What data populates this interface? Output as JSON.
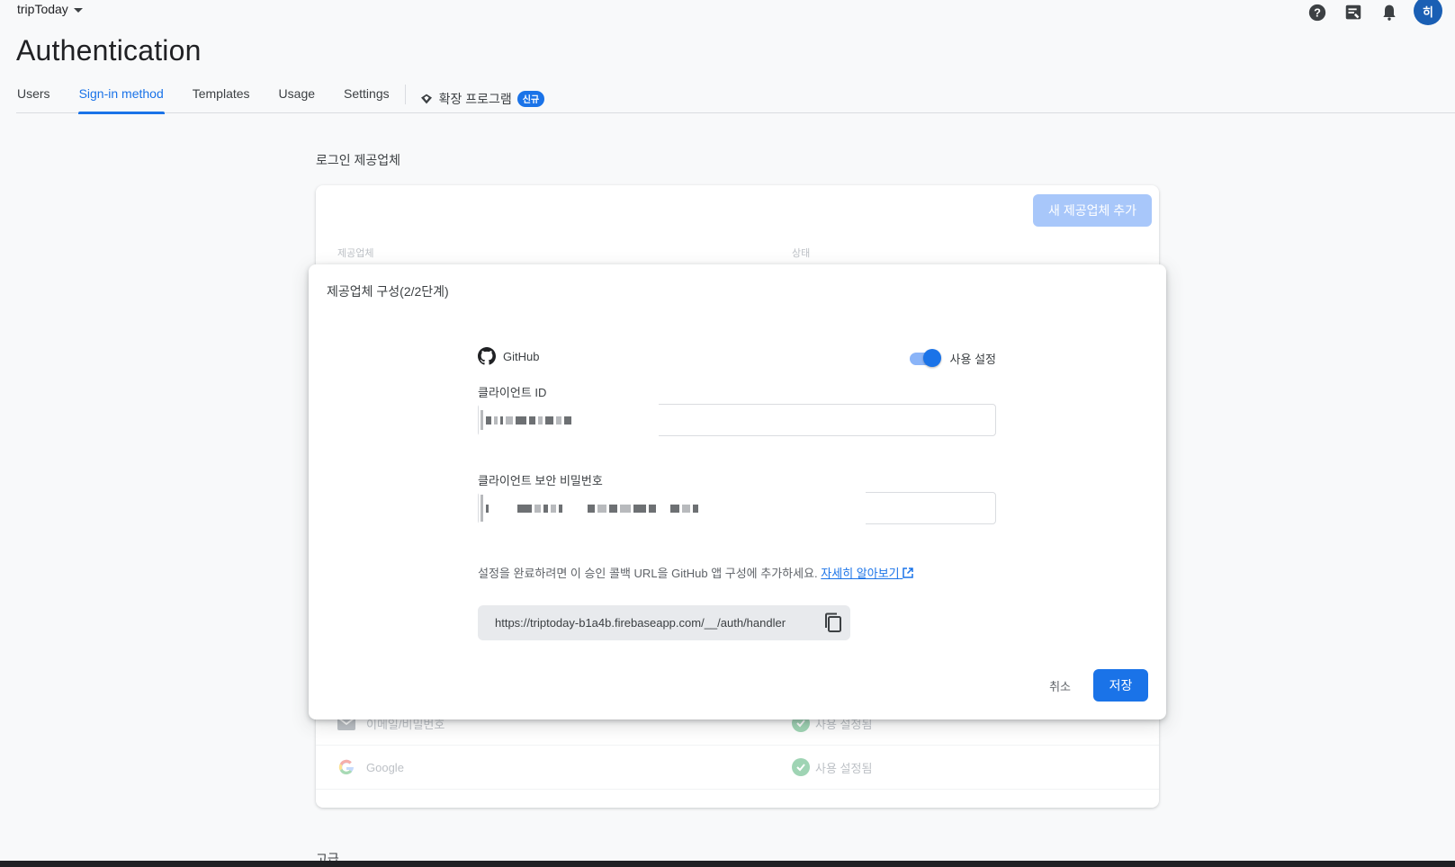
{
  "header": {
    "project_name": "tripToday",
    "page_title": "Authentication",
    "avatar_initial": "히",
    "icons": [
      "help-icon",
      "feedback-icon",
      "notifications-icon"
    ]
  },
  "tabs": [
    {
      "label": "Users"
    },
    {
      "label": "Sign-in method",
      "active": true
    },
    {
      "label": "Templates"
    },
    {
      "label": "Usage"
    },
    {
      "label": "Settings"
    }
  ],
  "extensions_tab": {
    "label": "확장 프로그램",
    "badge": "신규"
  },
  "providers_section": {
    "title": "로그인 제공업체",
    "add_button": "새 제공업체 추가",
    "col_provider": "제공업체",
    "col_status": "상태",
    "rows": [
      {
        "name": "이메일/비밀번호",
        "status": "사용 설정됨",
        "icon": "mail-icon"
      },
      {
        "name": "Google",
        "status": "사용 설정됨",
        "icon": "google-icon"
      }
    ]
  },
  "below_section_title": "고급",
  "dialog": {
    "title": "제공업체 구성(2/2단계)",
    "provider_name": "GitHub",
    "enable_label": "사용 설정",
    "enabled": true,
    "client_id_label": "클라이언트 ID",
    "client_secret_label": "클라이언트 보안 비밀번호",
    "help_text": "설정을 완료하려면 이 승인 콜백 URL을 GitHub 앱 구성에 추가하세요.",
    "help_link": "자세히 알아보기",
    "callback_url": "https://triptoday-b1a4b.firebaseapp.com/__/auth/handler",
    "cancel_label": "취소",
    "save_label": "저장"
  },
  "colors": {
    "accent": "#1a73e8",
    "accent_disabled": "#a8c7fa",
    "success": "#34a853"
  }
}
